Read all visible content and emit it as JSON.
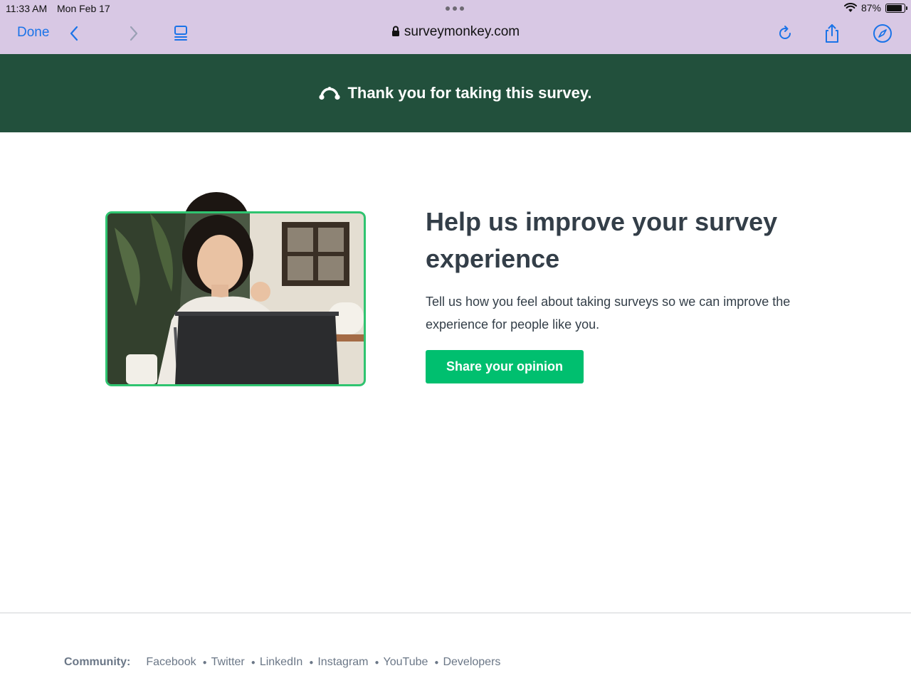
{
  "status_bar": {
    "time": "11:33 AM",
    "date": "Mon Feb 17",
    "battery": "87%",
    "battery_level": 0.87
  },
  "browser": {
    "done_label": "Done",
    "url": "surveymonkey.com",
    "accent_color": "#1a73e8"
  },
  "banner": {
    "text": "Thank you for taking this survey.",
    "background": "#22503c"
  },
  "main": {
    "headline": "Help us improve your survey experience",
    "body": "Tell us how you feel about taking surveys so we can improve the experience for people like you.",
    "cta_label": "Share your opinion",
    "cta_color": "#00bf6f"
  },
  "footer": {
    "community_label": "Community:",
    "links": [
      "Facebook",
      "Twitter",
      "LinkedIn",
      "Instagram",
      "YouTube",
      "Developers"
    ]
  }
}
